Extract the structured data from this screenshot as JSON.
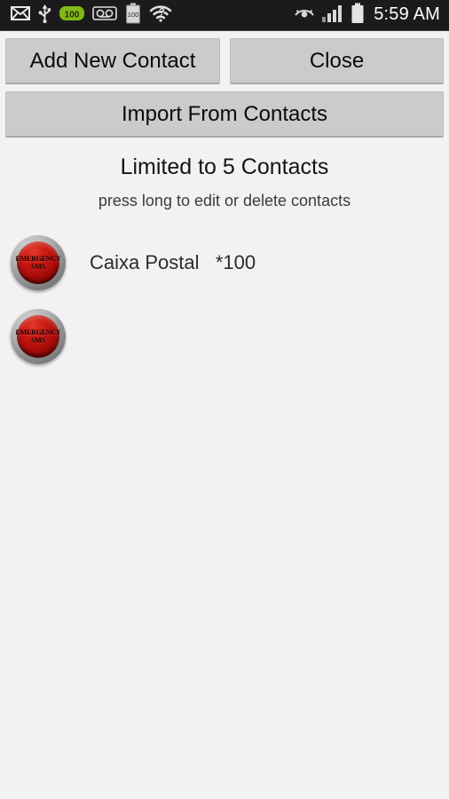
{
  "status_bar": {
    "background_color": "#1b1b1b",
    "left_icons": [
      {
        "name": "mail-icon",
        "label": "Unread mail"
      },
      {
        "name": "usb-icon",
        "label": "USB connected"
      },
      {
        "name": "battery-charge-badge-icon",
        "label": "100"
      },
      {
        "name": "voicemail-icon",
        "label": "Voicemail"
      },
      {
        "name": "battery-level-icon",
        "label": "100"
      },
      {
        "name": "wifi-unknown-icon",
        "label": "Wi-Fi unknown"
      }
    ],
    "right_icons": [
      {
        "name": "smart-stay-eye-icon",
        "label": "Smart stay"
      },
      {
        "name": "signal-bars-icon",
        "label": "Signal",
        "bars": 4
      },
      {
        "name": "battery-full-icon",
        "label": "Battery full"
      }
    ],
    "clock": "5:59 AM"
  },
  "toolbar": {
    "add_new_contact_label": "Add New Contact",
    "close_label": "Close",
    "import_from_contacts_label": "Import From Contacts"
  },
  "info": {
    "title": "Limited to 5 Contacts",
    "subtitle": "press long to edit or delete contacts"
  },
  "contacts": {
    "button_label_line1": "EMERGENCY",
    "button_label_line2": "SMS",
    "button_color": "#c01510",
    "rows": [
      {
        "text": "Caixa Postal   *100"
      },
      {
        "text": ""
      }
    ]
  }
}
